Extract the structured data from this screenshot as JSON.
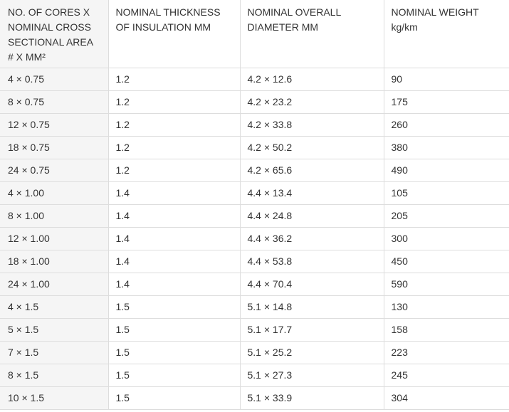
{
  "table": {
    "headers": [
      "NO. OF CORES X NOMINAL CROSS SECTIONAL AREA # X MM²",
      "NOMINAL THICKNESS OF INSULATION MM",
      "NOMINAL OVERALL DIAMETER MM",
      "NOMINAL WEIGHT kg/km"
    ],
    "rows": [
      [
        "4 × 0.75",
        "1.2",
        "4.2 × 12.6",
        "90"
      ],
      [
        "8 × 0.75",
        "1.2",
        "4.2 × 23.2",
        "175"
      ],
      [
        "12 × 0.75",
        "1.2",
        "4.2 × 33.8",
        "260"
      ],
      [
        "18 × 0.75",
        "1.2",
        "4.2 × 50.2",
        "380"
      ],
      [
        "24 × 0.75",
        "1.2",
        "4.2 × 65.6",
        "490"
      ],
      [
        "4 × 1.00",
        "1.4",
        "4.4 × 13.4",
        "105"
      ],
      [
        "8 × 1.00",
        "1.4",
        "4.4 × 24.8",
        "205"
      ],
      [
        "12 × 1.00",
        "1.4",
        "4.4 × 36.2",
        "300"
      ],
      [
        "18 × 1.00",
        "1.4",
        "4.4 × 53.8",
        "450"
      ],
      [
        "24 × 1.00",
        "1.4",
        "4.4 × 70.4",
        "590"
      ],
      [
        "4 × 1.5",
        "1.5",
        "5.1 × 14.8",
        "130"
      ],
      [
        "5 × 1.5",
        "1.5",
        "5.1 × 17.7",
        "158"
      ],
      [
        "7 × 1.5",
        "1.5",
        "5.1 × 25.2",
        "223"
      ],
      [
        "8 × 1.5",
        "1.5",
        "5.1 × 27.3",
        "245"
      ],
      [
        "10 × 1.5",
        "1.5",
        "5.1 × 33.9",
        "304"
      ]
    ]
  }
}
